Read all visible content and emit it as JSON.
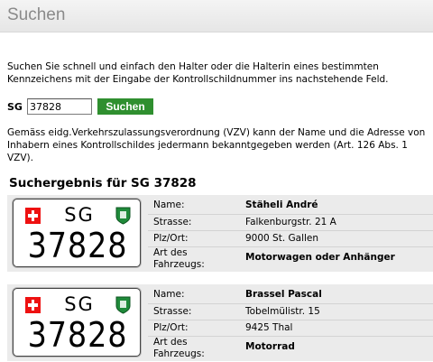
{
  "header": {
    "title": "Suchen"
  },
  "intro": "Suchen Sie schnell und einfach den Halter oder die Halterin eines bestimmten Kennzeichens mit der Eingabe der Kontrollschildnummer ins nachstehende Feld.",
  "search": {
    "canton_label": "SG",
    "value": "37828",
    "button_label": "Suchen"
  },
  "legal": "Gemäss eidg.Verkehrszulassungsverordnung (VZV) kann der Name und die Adresse von Inhabern eines Kontrollschildes jedermann bekanntgegeben werden (Art. 126 Abs. 1 VZV).",
  "results_title": "Suchergebnis für SG 37828",
  "labels": {
    "name": "Name:",
    "street": "Strasse:",
    "city": "Plz/Ort:",
    "vehicle_1": "Art des",
    "vehicle_2": "Fahrzeugs:"
  },
  "results": [
    {
      "plate_canton": "SG",
      "plate_number": "37828",
      "name": "Stäheli André",
      "street": "Falkenburgstr. 21 A",
      "city": "9000 St. Gallen",
      "vehicle": "Motorwagen oder Anhänger"
    },
    {
      "plate_canton": "SG",
      "plate_number": "37828",
      "name": "Brassel Pascal",
      "street": "Tobelmülistr. 15",
      "city": "9425 Thal",
      "vehicle": "Motorrad"
    }
  ]
}
